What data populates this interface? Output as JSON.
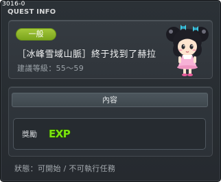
{
  "window": {
    "version": "3016-0",
    "title": "QUEST INFO"
  },
  "quest": {
    "category_badge": "一般",
    "name": "［冰峰雪域山脈］終于找到了赫拉",
    "level_label": "建議等級：55～59"
  },
  "content": {
    "header": "內容",
    "reward_label": "獎勵",
    "reward_icon": "exp-icon",
    "reward_text": "EXP"
  },
  "status": {
    "text": "狀態：可開始 / 不可執行任務"
  },
  "colors": {
    "badge_green": "#8fb52a",
    "exp_green": "#7be30f",
    "exp_outline": "#1f4a00",
    "window_bg": "#2b3136"
  },
  "npc": {
    "icon": "npc-girl-portrait"
  }
}
